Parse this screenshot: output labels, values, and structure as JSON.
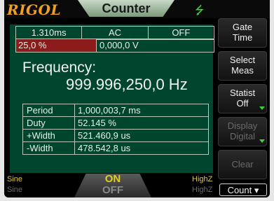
{
  "header": {
    "brand": "RIGOL",
    "title": "Counter",
    "usb_icon": "usb-icon"
  },
  "status_row1": [
    "1.310ms",
    "AC",
    "OFF"
  ],
  "status_row2": {
    "duty_bar": "25,0 %",
    "voltage": "0,000,0 V",
    "bar_color": "#8c1c1c"
  },
  "frequency": {
    "label": "Frequency:",
    "value": "999.996,250,0 Hz"
  },
  "stats": [
    {
      "label": "Period",
      "value": "1,000,003,7 ms"
    },
    {
      "label": "Duty",
      "value": "52.145 %"
    },
    {
      "label": "+Width",
      "value": "521.460,9 us"
    },
    {
      "label": "-Width",
      "value": "478.542,8 us"
    }
  ],
  "menu": [
    {
      "l1": "Gate",
      "l2": "Time",
      "enabled": true
    },
    {
      "l1": "Select",
      "l2": "Meas",
      "enabled": true
    },
    {
      "l1": "Statist",
      "l2": "Off",
      "enabled": true
    },
    {
      "l1": "Display",
      "l2": "Digital",
      "enabled": false
    },
    {
      "l1": "Clear",
      "l2": "",
      "enabled": false
    }
  ],
  "count_button": "Count",
  "bottom": {
    "wave1": "Sine",
    "wave2": "Sine",
    "on": "ON",
    "off": "OFF",
    "imp1": "HighZ",
    "imp2": "HighZ"
  },
  "colors": {
    "accent_green": "#3bd23b",
    "panel_bg": "#00452e",
    "brand": "#f0a020"
  }
}
